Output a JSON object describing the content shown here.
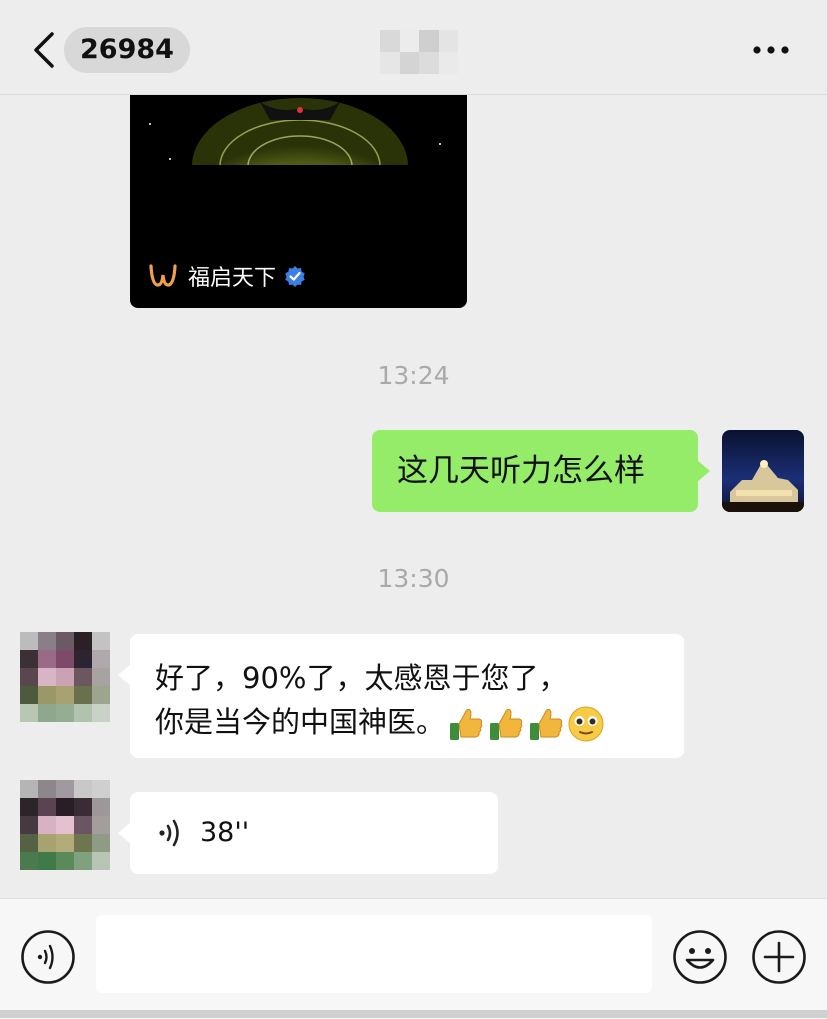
{
  "header": {
    "back_icon": "chevron-left-icon",
    "unread_count": "26984",
    "title": "",
    "more_icon": "ellipsis-icon"
  },
  "shared_card": {
    "source_name": "福启天下",
    "source_icon": "brand-logo-icon",
    "verified_icon": "verified-badge-icon"
  },
  "messages": [
    {
      "type": "time",
      "text": "13:24"
    },
    {
      "type": "text",
      "from": "me",
      "text": "这几天听力怎么样"
    },
    {
      "type": "time",
      "text": "13:30"
    },
    {
      "type": "text",
      "from": "them",
      "line1": "好了，90%了，太感恩于您了，",
      "line2": "你是当今的中国神医。",
      "emojis": [
        "thumbs-up",
        "thumbs-up",
        "thumbs-up",
        "pleading-face"
      ]
    },
    {
      "type": "voice",
      "from": "them",
      "duration": "38''"
    }
  ],
  "input_bar": {
    "voice_icon": "voice-toggle-icon",
    "input_value": "",
    "emoji_icon": "smiley-icon",
    "plus_icon": "plus-circle-icon"
  },
  "colors": {
    "background": "#ededed",
    "my_bubble": "#95ec69",
    "their_bubble": "#ffffff",
    "time_text": "#a9a9a9"
  }
}
